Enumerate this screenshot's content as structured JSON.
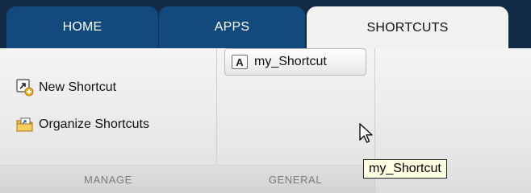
{
  "tabs": [
    {
      "label": "HOME"
    },
    {
      "label": "APPS"
    },
    {
      "label": "SHORTCUTS"
    }
  ],
  "manage": {
    "new_shortcut": "New Shortcut",
    "organize_shortcuts": "Organize Shortcuts",
    "section_label": "MANAGE"
  },
  "general": {
    "shortcut_label": "my_Shortcut",
    "shortcut_icon_letter": "A",
    "section_label": "GENERAL"
  },
  "tooltip": {
    "text": "my_Shortcut"
  },
  "icons": {
    "new_shortcut": "new-shortcut-icon",
    "organize_shortcuts": "organize-shortcuts-folder-icon",
    "shortcut": "letter-a-icon",
    "cursor": "mouse-pointer-icon"
  },
  "colors": {
    "tabbar": "#122a44",
    "tab_inactive": "#124a7e",
    "tab_active": "#f1f1f1",
    "tooltip_bg": "#ffffe1"
  }
}
